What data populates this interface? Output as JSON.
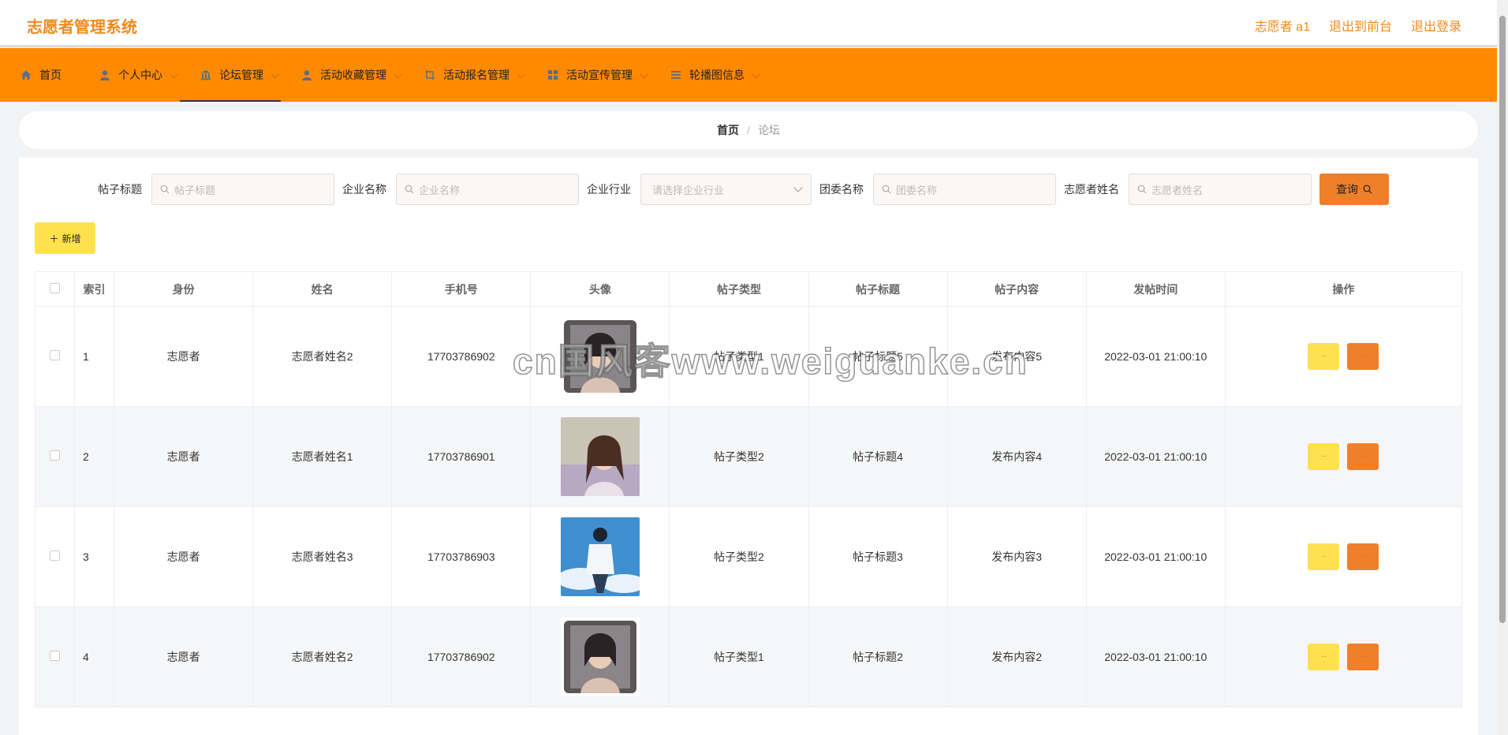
{
  "header": {
    "brand": "志愿者管理系统",
    "user": "志愿者 a1",
    "to_front": "退出到前台",
    "logout": "退出登录"
  },
  "nav": [
    {
      "label": "首页",
      "icon": "home-icon"
    },
    {
      "label": "个人中心",
      "icon": "user-icon"
    },
    {
      "label": "论坛管理",
      "icon": "bank-icon"
    },
    {
      "label": "活动收藏管理",
      "icon": "user-icon"
    },
    {
      "label": "活动报名管理",
      "icon": "crop-icon"
    },
    {
      "label": "活动宣传管理",
      "icon": "grid-icon"
    },
    {
      "label": "轮播图信息",
      "icon": "list-icon"
    }
  ],
  "breadcrumb": {
    "home": "首页",
    "sep": "/",
    "current": "论坛"
  },
  "search": {
    "title_label": "帖子标题",
    "title_placeholder": "帖子标题",
    "company_label": "企业名称",
    "company_placeholder": "企业名称",
    "industry_label": "企业行业",
    "industry_placeholder": "请选择企业行业",
    "league_label": "团委名称",
    "league_placeholder": "团委名称",
    "volunteer_label": "志愿者姓名",
    "volunteer_placeholder": "志愿者姓名",
    "query_label": "查询"
  },
  "add_label": "新增",
  "table": {
    "headers": [
      "",
      "索引",
      "身份",
      "姓名",
      "手机号",
      "头像",
      "帖子类型",
      "帖子标题",
      "帖子内容",
      "发帖时间",
      "操作"
    ],
    "rows": [
      {
        "index": "1",
        "role": "志愿者",
        "name": "志愿者姓名2",
        "phone": "17703786902",
        "avatar": "woman-pillow",
        "type": "帖子类型1",
        "title": "帖子标题5",
        "content": "发布内容5",
        "time": "2022-03-01 21:00:10"
      },
      {
        "index": "2",
        "role": "志愿者",
        "name": "志愿者姓名1",
        "phone": "17703786901",
        "avatar": "woman-flowers",
        "type": "帖子类型2",
        "title": "帖子标题4",
        "content": "发布内容4",
        "time": "2022-03-01 21:00:10"
      },
      {
        "index": "3",
        "role": "志愿者",
        "name": "志愿者姓名3",
        "phone": "17703786903",
        "avatar": "man-sky",
        "type": "帖子类型2",
        "title": "帖子标题3",
        "content": "发布内容3",
        "time": "2022-03-01 21:00:10"
      },
      {
        "index": "4",
        "role": "志愿者",
        "name": "志愿者姓名2",
        "phone": "17703786902",
        "avatar": "woman-pillow",
        "type": "帖子类型1",
        "title": "帖子标题2",
        "content": "发布内容2",
        "time": "2022-03-01 21:00:10"
      }
    ]
  },
  "watermark": "cn国风客www.weiguanke.cn",
  "colors": {
    "accent": "#ff8a00",
    "brand_text": "#f08a1c",
    "query": "#f07f2a",
    "add": "#ffe150"
  }
}
